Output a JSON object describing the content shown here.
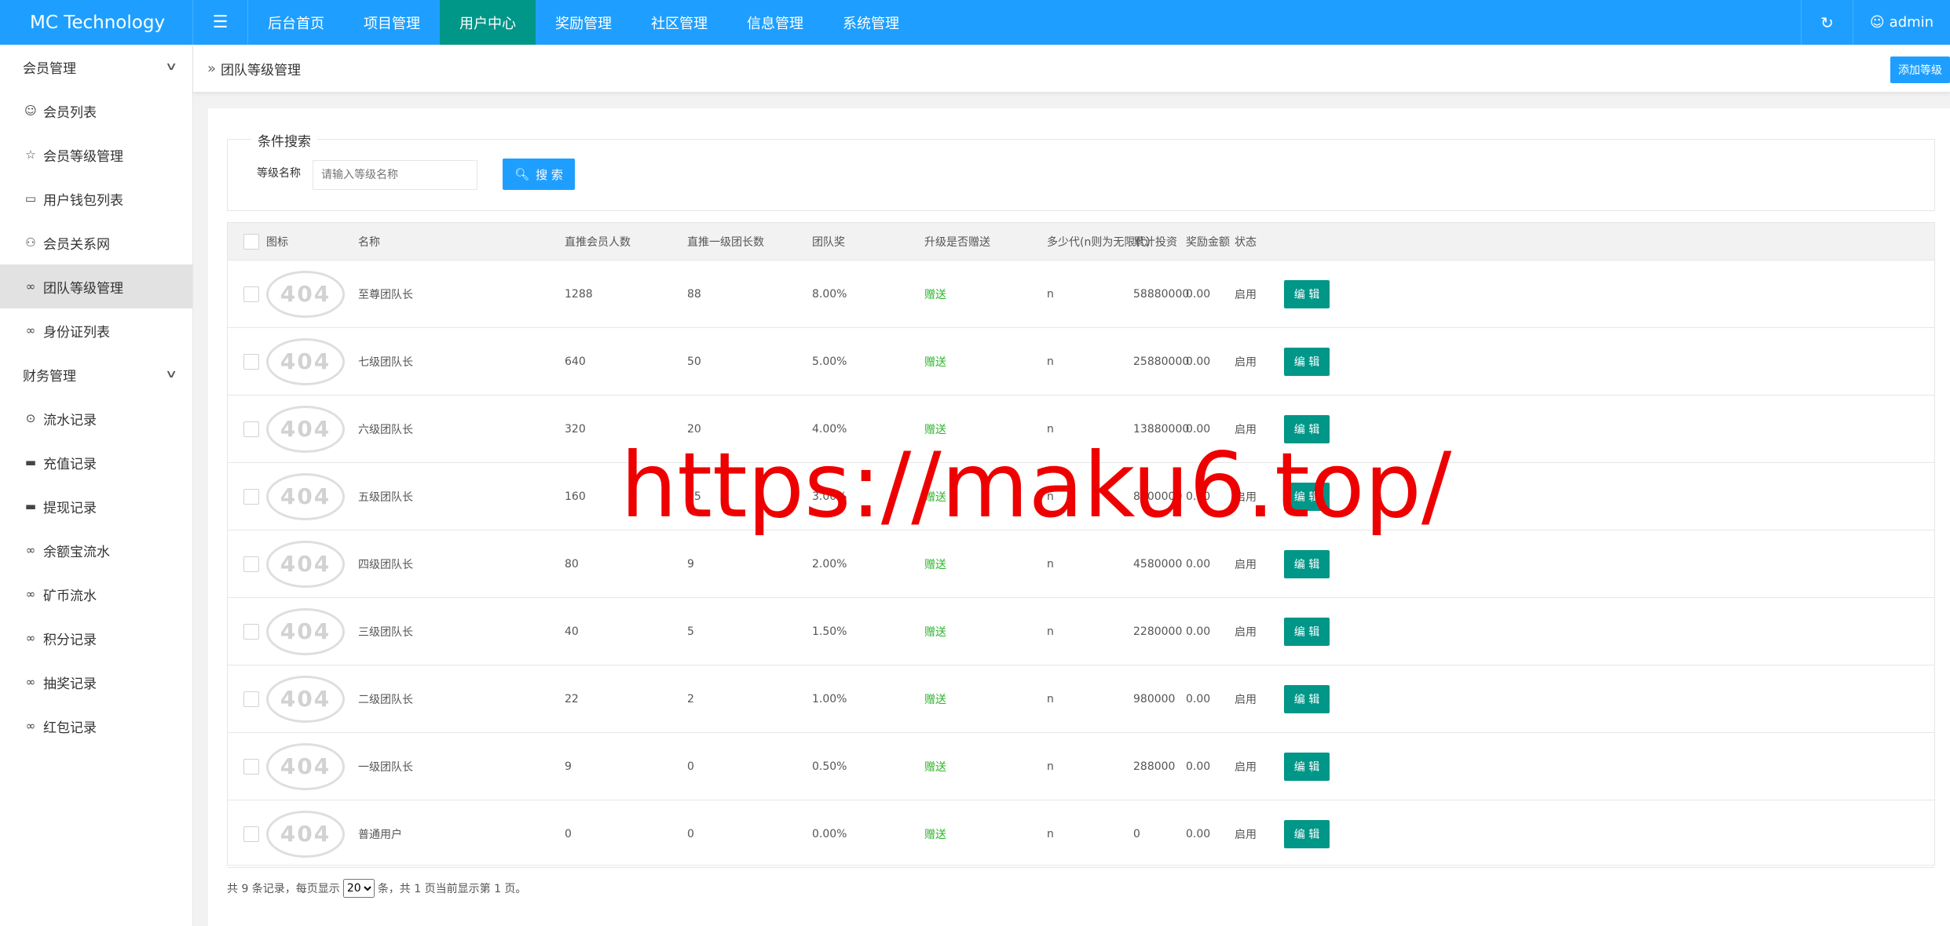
{
  "header": {
    "brand": "MC Technology",
    "menu_icon": "☰",
    "nav": [
      "后台首页",
      "项目管理",
      "用户中心",
      "奖励管理",
      "社区管理",
      "信息管理",
      "系统管理"
    ],
    "active_nav": "用户中心",
    "user": "admin"
  },
  "sidebar": {
    "groups": [
      {
        "label": "会员管理",
        "items": [
          "会员列表",
          "会员等级管理",
          "用户钱包列表",
          "会员关系网",
          "团队等级管理",
          "身份证列表"
        ]
      },
      {
        "label": "财务管理",
        "items": [
          "流水记录",
          "充值记录",
          "提现记录",
          "余额宝流水",
          "矿币流水",
          "积分记录",
          "抽奖记录",
          "红包记录"
        ]
      }
    ],
    "active_item": "团队等级管理"
  },
  "breadcrumb": {
    "title": "团队等级管理",
    "add_button": "添加等级"
  },
  "search": {
    "legend": "条件搜索",
    "label": "等级名称",
    "placeholder": "请输入等级名称",
    "button": "搜 索"
  },
  "table": {
    "columns": [
      "图标",
      "名称",
      "直推会员人数",
      "直推一级团长数",
      "团队奖",
      "升级是否赠送",
      "多少代(n则为无限代)",
      "累计投资",
      "奖励金额",
      "状态"
    ],
    "icon_text": "404",
    "edit_label": "编 辑",
    "rows": [
      {
        "name": "至尊团队长",
        "direct_members": "1288",
        "direct_leaders": "88",
        "team_bonus": "8.00%",
        "gift": "赠送",
        "generations": "n",
        "investment": "58880000",
        "reward": "0.00",
        "status": "启用"
      },
      {
        "name": "七级团队长",
        "direct_members": "640",
        "direct_leaders": "50",
        "team_bonus": "5.00%",
        "gift": "赠送",
        "generations": "n",
        "investment": "25880000",
        "reward": "0.00",
        "status": "启用"
      },
      {
        "name": "六级团队长",
        "direct_members": "320",
        "direct_leaders": "20",
        "team_bonus": "4.00%",
        "gift": "赠送",
        "generations": "n",
        "investment": "13880000",
        "reward": "0.00",
        "status": "启用"
      },
      {
        "name": "五级团队长",
        "direct_members": "160",
        "direct_leaders": "15",
        "team_bonus": "3.00%",
        "gift": "赠送",
        "generations": "n",
        "investment": "8800000",
        "reward": "0.00",
        "status": "启用"
      },
      {
        "name": "四级团队长",
        "direct_members": "80",
        "direct_leaders": "9",
        "team_bonus": "2.00%",
        "gift": "赠送",
        "generations": "n",
        "investment": "4580000",
        "reward": "0.00",
        "status": "启用"
      },
      {
        "name": "三级团队长",
        "direct_members": "40",
        "direct_leaders": "5",
        "team_bonus": "1.50%",
        "gift": "赠送",
        "generations": "n",
        "investment": "2280000",
        "reward": "0.00",
        "status": "启用"
      },
      {
        "name": "二级团队长",
        "direct_members": "22",
        "direct_leaders": "2",
        "team_bonus": "1.00%",
        "gift": "赠送",
        "generations": "n",
        "investment": "980000",
        "reward": "0.00",
        "status": "启用"
      },
      {
        "name": "一级团队长",
        "direct_members": "9",
        "direct_leaders": "0",
        "team_bonus": "0.50%",
        "gift": "赠送",
        "generations": "n",
        "investment": "288000",
        "reward": "0.00",
        "status": "启用"
      },
      {
        "name": "普通用户",
        "direct_members": "0",
        "direct_leaders": "0",
        "team_bonus": "0.00%",
        "gift": "赠送",
        "generations": "n",
        "investment": "0",
        "reward": "0.00",
        "status": "启用"
      }
    ]
  },
  "pager": {
    "prefix": "共 9 条记录，每页显示",
    "page_size": "20",
    "suffix": "条，共 1 页当前显示第 1 页。"
  },
  "watermark": "https://maku6.top/",
  "colors": {
    "primary": "#1e9fff",
    "active_nav": "#009688",
    "edit_button": "#009688",
    "gift_text": "#2bb52b"
  }
}
